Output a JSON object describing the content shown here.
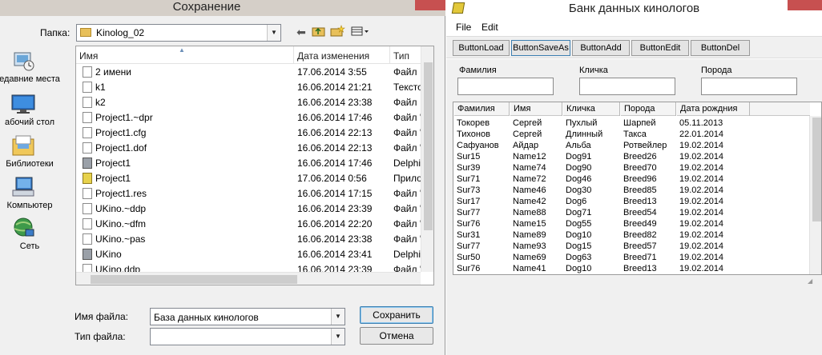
{
  "save_dialog": {
    "title": "Сохранение",
    "folder_label": "Папка:",
    "folder_value": "Kinolog_02",
    "places": [
      {
        "label": "едавние места",
        "icon": "recent-places-icon"
      },
      {
        "label": "абочий стол",
        "icon": "desktop-icon"
      },
      {
        "label": "Библиотеки",
        "icon": "libraries-icon"
      },
      {
        "label": "Компьютер",
        "icon": "computer-icon"
      },
      {
        "label": "Сеть",
        "icon": "network-icon"
      }
    ],
    "columns": {
      "name": "Имя",
      "date": "Дата изменения",
      "type": "Тип"
    },
    "files": [
      {
        "name": "2 имени",
        "date": "17.06.2014 3:55",
        "type": "Файл",
        "icon": "file-icon"
      },
      {
        "name": "k1",
        "date": "16.06.2014 21:21",
        "type": "Тексто",
        "icon": "text-file-icon"
      },
      {
        "name": "k2",
        "date": "16.06.2014 23:38",
        "type": "Файл",
        "icon": "file-icon"
      },
      {
        "name": "Project1.~dpr",
        "date": "16.06.2014 17:46",
        "type": "Файл '",
        "icon": "file-icon"
      },
      {
        "name": "Project1.cfg",
        "date": "16.06.2014 22:13",
        "type": "Файл '",
        "icon": "file-icon"
      },
      {
        "name": "Project1.dof",
        "date": "16.06.2014 22:13",
        "type": "Файл '",
        "icon": "file-icon"
      },
      {
        "name": "Project1",
        "date": "16.06.2014 17:46",
        "type": "Delphi",
        "icon": "delphi-project-icon"
      },
      {
        "name": "Project1",
        "date": "17.06.2014 0:56",
        "type": "Прило",
        "icon": "application-icon"
      },
      {
        "name": "Project1.res",
        "date": "16.06.2014 17:15",
        "type": "Файл '",
        "icon": "file-icon"
      },
      {
        "name": "UKino.~ddp",
        "date": "16.06.2014 23:39",
        "type": "Файл '",
        "icon": "file-icon"
      },
      {
        "name": "UKino.~dfm",
        "date": "16.06.2014 22:20",
        "type": "Файл '",
        "icon": "file-icon"
      },
      {
        "name": "UKino.~pas",
        "date": "16.06.2014 23:38",
        "type": "Файл '",
        "icon": "file-icon"
      },
      {
        "name": "UKino",
        "date": "16.06.2014 23:41",
        "type": "Delphi",
        "icon": "delphi-project-icon"
      },
      {
        "name": "UKino.ddp",
        "date": "16.06.2014 23:39",
        "type": "Файл '",
        "icon": "file-icon"
      }
    ],
    "filename_label": "Имя файла:",
    "filename_value": "База данных кинологов",
    "filetype_label": "Тип файла:",
    "filetype_value": "",
    "save_label": "Сохранить",
    "cancel_label": "Отмена"
  },
  "app": {
    "title": "Банк данных кинологов",
    "menu": {
      "file": "File",
      "edit": "Edit"
    },
    "toolbar": {
      "load": "ButtonLoad",
      "save_as": "ButtonSaveAs",
      "add": "ButtonAdd",
      "edit": "ButtonEdit",
      "del": "ButtonDel"
    },
    "filters": {
      "surname_label": "Фамилия",
      "nickname_label": "Кличка",
      "breed_label": "Порода"
    },
    "grid": {
      "columns": [
        "Фамилия",
        "Имя",
        "Кличка",
        "Порода",
        "Дата рождния"
      ],
      "rows": [
        [
          "Токорев",
          "Сергей",
          "Пухлый",
          "Шарпей",
          "05.11.2013"
        ],
        [
          "Тихонов",
          "Сергей",
          "Длинный",
          "Такса",
          "22.01.2014"
        ],
        [
          "Сафуанов",
          "Айдар",
          "Альба",
          "Ротвейлер",
          "19.02.2014"
        ],
        [
          "Sur15",
          "Name12",
          "Dog91",
          "Breed26",
          "19.02.2014"
        ],
        [
          "Sur39",
          "Name74",
          "Dog90",
          "Breed70",
          "19.02.2014"
        ],
        [
          "Sur71",
          "Name72",
          "Dog46",
          "Breed96",
          "19.02.2014"
        ],
        [
          "Sur73",
          "Name46",
          "Dog30",
          "Breed85",
          "19.02.2014"
        ],
        [
          "Sur17",
          "Name42",
          "Dog6",
          "Breed13",
          "19.02.2014"
        ],
        [
          "Sur77",
          "Name88",
          "Dog71",
          "Breed54",
          "19.02.2014"
        ],
        [
          "Sur76",
          "Name15",
          "Dog55",
          "Breed49",
          "19.02.2014"
        ],
        [
          "Sur31",
          "Name89",
          "Dog10",
          "Breed82",
          "19.02.2014"
        ],
        [
          "Sur77",
          "Name93",
          "Dog15",
          "Breed57",
          "19.02.2014"
        ],
        [
          "Sur50",
          "Name69",
          "Dog63",
          "Breed71",
          "19.02.2014"
        ],
        [
          "Sur76",
          "Name41",
          "Dog10",
          "Breed13",
          "19.02.2014"
        ]
      ]
    }
  },
  "colors": {
    "close_button": "#c75050",
    "dialog_bg": "#f0f0f0",
    "title_bg": "#d5cfc8"
  }
}
